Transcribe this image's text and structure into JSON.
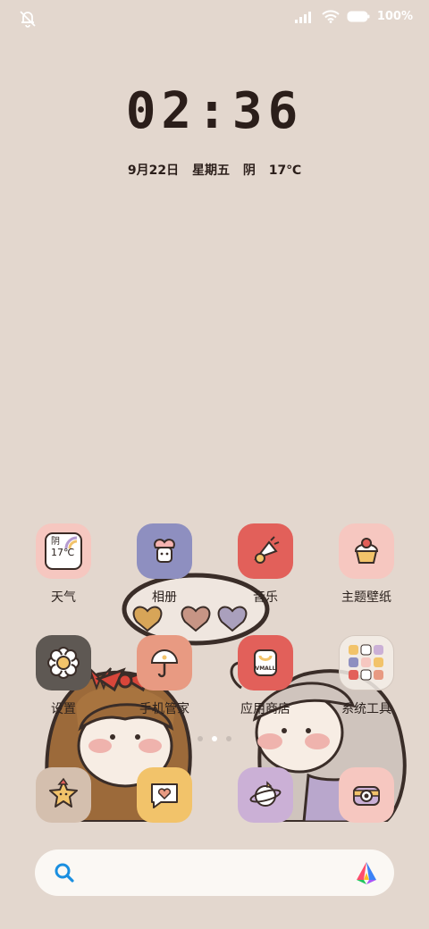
{
  "status": {
    "battery_text": "100%",
    "icons": [
      "mute-bell-icon",
      "signal-icon",
      "wifi-icon",
      "battery-icon"
    ]
  },
  "lockscreen": {
    "time": "02:36",
    "date": "9月22日",
    "weekday": "星期五",
    "weather": "阴",
    "temperature": "17℃"
  },
  "apps_row1": [
    {
      "label": "天气",
      "icon": "weather-icon"
    },
    {
      "label": "相册",
      "icon": "gallery-icon"
    },
    {
      "label": "音乐",
      "icon": "music-icon"
    },
    {
      "label": "主题壁纸",
      "icon": "themes-icon"
    }
  ],
  "apps_row2": [
    {
      "label": "设置",
      "icon": "settings-icon"
    },
    {
      "label": "手机管家",
      "icon": "security-icon"
    },
    {
      "label": "应用商店",
      "icon": "app-store-icon"
    },
    {
      "label": "系统工具",
      "icon": "folder-icon"
    }
  ],
  "weather_widget": {
    "condition": "阴",
    "temp": "17℃"
  },
  "app_store_badge": "VMALL",
  "dock": [
    "phone-icon",
    "messages-icon",
    "browser-icon",
    "camera-icon"
  ],
  "page_indicator": {
    "count": 3,
    "active": 1
  },
  "colors": {
    "background": "#e3d7ce",
    "weather": "#f6c7c0",
    "gallery": "#8e8fc0",
    "music": "#e2605a",
    "themes": "#f6c7c0",
    "settings": "#5e5853",
    "security": "#e89a82",
    "app_store": "#e2605a",
    "phone": "#d4bfae",
    "messages": "#f2c36a",
    "browser": "#cbb0d6",
    "camera": "#f6c7c0"
  }
}
